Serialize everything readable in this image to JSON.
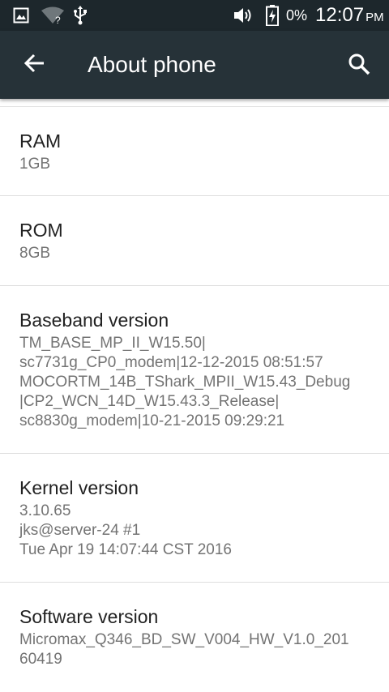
{
  "status_bar": {
    "icons": [
      "image-icon",
      "wifi-unknown-icon",
      "usb-icon",
      "volume-icon",
      "battery-charging-icon"
    ],
    "battery_text": "0%",
    "time": "12:07",
    "ampm": "PM"
  },
  "app_bar": {
    "title": "About phone",
    "back_icon": "arrow-back-icon",
    "search_icon": "search-icon",
    "background": "#263238"
  },
  "items": [
    {
      "label": "RAM",
      "value": "1GB"
    },
    {
      "label": "ROM",
      "value": "8GB"
    },
    {
      "label": "Baseband version",
      "value": "TM_BASE_MP_II_W15.50|\nsc7731g_CP0_modem|12-12-2015 08:51:57\nMOCORTM_14B_TShark_MPII_W15.43_Debug\n|CP2_WCN_14D_W15.43.3_Release|\nsc8830g_modem|10-21-2015 09:29:21"
    },
    {
      "label": "Kernel version",
      "value": "3.10.65\njks@server-24 #1\nTue Apr 19 14:07:44 CST 2016"
    },
    {
      "label": "Software version",
      "value": "Micromax_Q346_BD_SW_V004_HW_V1.0_201\n60419"
    }
  ]
}
